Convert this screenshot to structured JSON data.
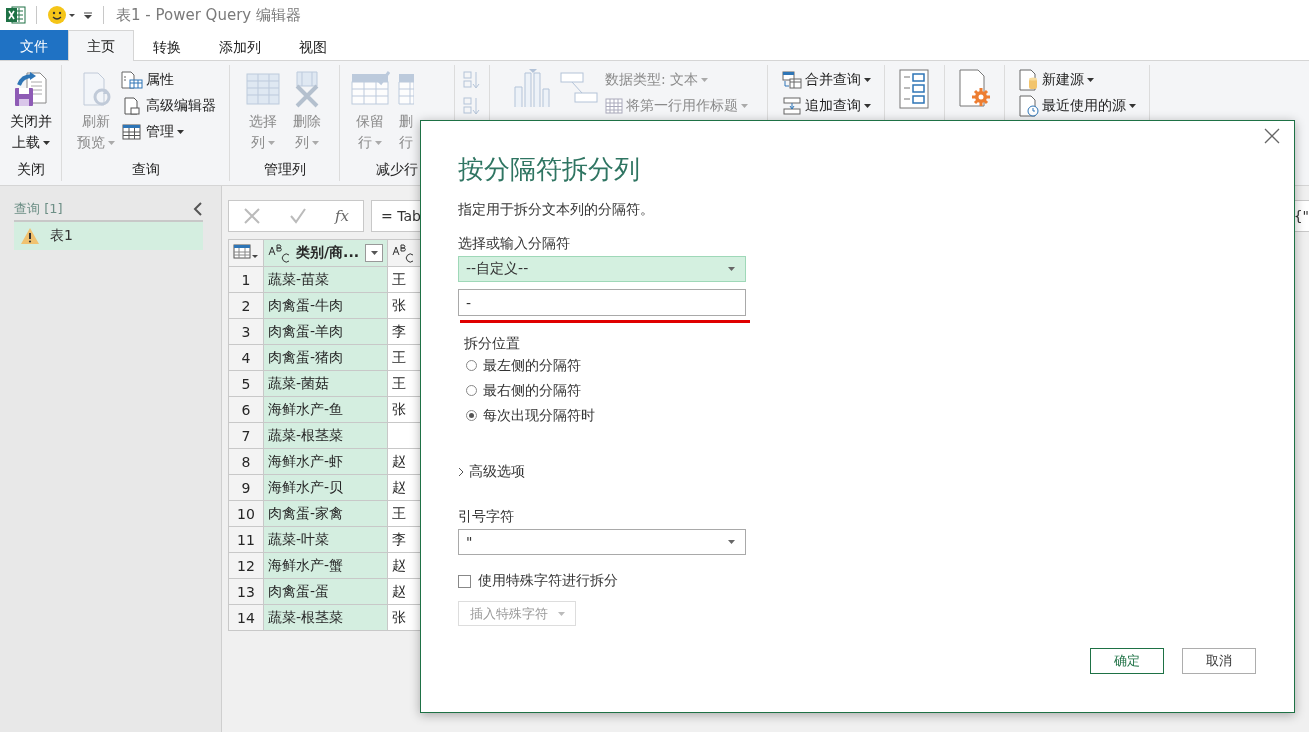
{
  "title_bar": {
    "title": "表1 - Power Query 编辑器"
  },
  "tabs": [
    {
      "label": "文件",
      "kind": "file",
      "selected": false
    },
    {
      "label": "主页",
      "kind": "tab",
      "selected": true
    },
    {
      "label": "转换",
      "kind": "tab",
      "selected": false
    },
    {
      "label": "添加列",
      "kind": "tab",
      "selected": false
    },
    {
      "label": "视图",
      "kind": "tab",
      "selected": false
    }
  ],
  "ribbon": {
    "groups": [
      {
        "label": "关闭",
        "buttons": [
          {
            "kind": "large",
            "lines": [
              "关闭并",
              "上载"
            ],
            "dropdown": true,
            "disabled": false
          }
        ]
      },
      {
        "label": "查询",
        "buttons": [
          {
            "kind": "large",
            "lines": [
              "刷新",
              "预览"
            ],
            "dropdown": true,
            "disabled": true
          },
          {
            "kind": "small",
            "label": "属性",
            "dropdown": false,
            "disabled": false
          },
          {
            "kind": "small",
            "label": "高级编辑器",
            "dropdown": false,
            "disabled": false
          },
          {
            "kind": "small",
            "label": "管理",
            "dropdown": true,
            "disabled": false
          }
        ]
      },
      {
        "label": "管理列",
        "buttons": [
          {
            "kind": "large",
            "lines": [
              "选择",
              "列"
            ],
            "dropdown": true,
            "disabled": true
          },
          {
            "kind": "large",
            "lines": [
              "删除",
              "列"
            ],
            "dropdown": true,
            "disabled": true
          }
        ]
      },
      {
        "label": "减少行",
        "buttons": [
          {
            "kind": "large",
            "lines": [
              "保留",
              "行"
            ],
            "dropdown": true,
            "disabled": true
          },
          {
            "kind": "large",
            "lines": [
              "删",
              "行"
            ],
            "dropdown": false,
            "disabled": true
          }
        ]
      },
      {
        "buttons": [
          {
            "kind": "small"
          },
          {
            "kind": "small"
          }
        ]
      },
      {
        "buttons": [
          {
            "kind": "large"
          },
          {
            "kind": "large"
          },
          {
            "kind": "small",
            "label": "数据类型: 文本",
            "dropdown": true,
            "disabled": true
          },
          {
            "kind": "small",
            "label": "将第一行用作标题",
            "dropdown": true,
            "disabled": true
          }
        ]
      },
      {
        "buttons": [
          {
            "kind": "small",
            "label": "合并查询",
            "dropdown": true,
            "disabled": false
          },
          {
            "kind": "small",
            "label": "追加查询",
            "dropdown": true,
            "disabled": false
          }
        ]
      },
      {
        "buttons": [
          {
            "kind": "large"
          }
        ]
      },
      {
        "buttons": [
          {
            "kind": "large"
          }
        ]
      },
      {
        "buttons": [
          {
            "kind": "small",
            "label": "新建源",
            "dropdown": true,
            "disabled": false
          },
          {
            "kind": "small",
            "label": "最近使用的源",
            "dropdown": true,
            "disabled": false
          }
        ]
      }
    ]
  },
  "queries": {
    "header": "查询 [1]",
    "items": [
      {
        "label": "表1",
        "selected": true
      }
    ]
  },
  "formula_bar": {
    "fx_label": "fx",
    "formula": "= Tab",
    "formula_tail": "{\""
  },
  "table": {
    "columns": [
      {
        "title": "类别/商...",
        "selected": true,
        "filter": true
      },
      {
        "selected": false,
        "filter": false
      }
    ],
    "rows": [
      {
        "number": "1",
        "cells": [
          "蔬菜-苗菜",
          "王"
        ]
      },
      {
        "number": "2",
        "cells": [
          "肉禽蛋-牛肉",
          "张"
        ]
      },
      {
        "number": "3",
        "cells": [
          "肉禽蛋-羊肉",
          "李"
        ]
      },
      {
        "number": "4",
        "cells": [
          "肉禽蛋-猪肉",
          "王"
        ]
      },
      {
        "number": "5",
        "cells": [
          "蔬菜-菌菇",
          "王"
        ]
      },
      {
        "number": "6",
        "cells": [
          "海鲜水产-鱼",
          "张"
        ]
      },
      {
        "number": "7",
        "cells": [
          "蔬菜-根茎菜",
          null
        ]
      },
      {
        "number": "8",
        "cells": [
          "海鲜水产-虾",
          "赵"
        ]
      },
      {
        "number": "9",
        "cells": [
          "海鲜水产-贝",
          "赵"
        ]
      },
      {
        "number": "10",
        "cells": [
          "肉禽蛋-家禽",
          "王"
        ]
      },
      {
        "number": "11",
        "cells": [
          "蔬菜-叶菜",
          "李"
        ]
      },
      {
        "number": "12",
        "cells": [
          "海鲜水产-蟹",
          "赵"
        ]
      },
      {
        "number": "13",
        "cells": [
          "肉禽蛋-蛋",
          "赵"
        ]
      },
      {
        "number": "14",
        "cells": [
          "蔬菜-根茎菜",
          "张"
        ]
      }
    ]
  },
  "dialog": {
    "title": "按分隔符拆分列",
    "description": "指定用于拆分文本列的分隔符。",
    "delimiter_label": "选择或输入分隔符",
    "delimiter_select": {
      "value": "--自定义--"
    },
    "delimiter_input": {
      "value": "-"
    },
    "split_at_label": "拆分位置",
    "split_at_options": [
      {
        "label": "最左侧的分隔符",
        "selected": false
      },
      {
        "label": "最右侧的分隔符",
        "selected": false
      },
      {
        "label": "每次出现分隔符时",
        "selected": true
      }
    ],
    "advanced": {
      "label": "高级选项",
      "expanded": false
    },
    "quote_label": "引号字符",
    "quote_select": {
      "value": "\""
    },
    "special_chars": {
      "label": "使用特殊字符进行拆分",
      "checked": false
    },
    "insert_button": {
      "label": "插入特殊字符",
      "disabled": true
    },
    "buttons": [
      {
        "label": "确定",
        "kind": "primary"
      },
      {
        "label": "取消",
        "kind": "secondary"
      }
    ]
  }
}
